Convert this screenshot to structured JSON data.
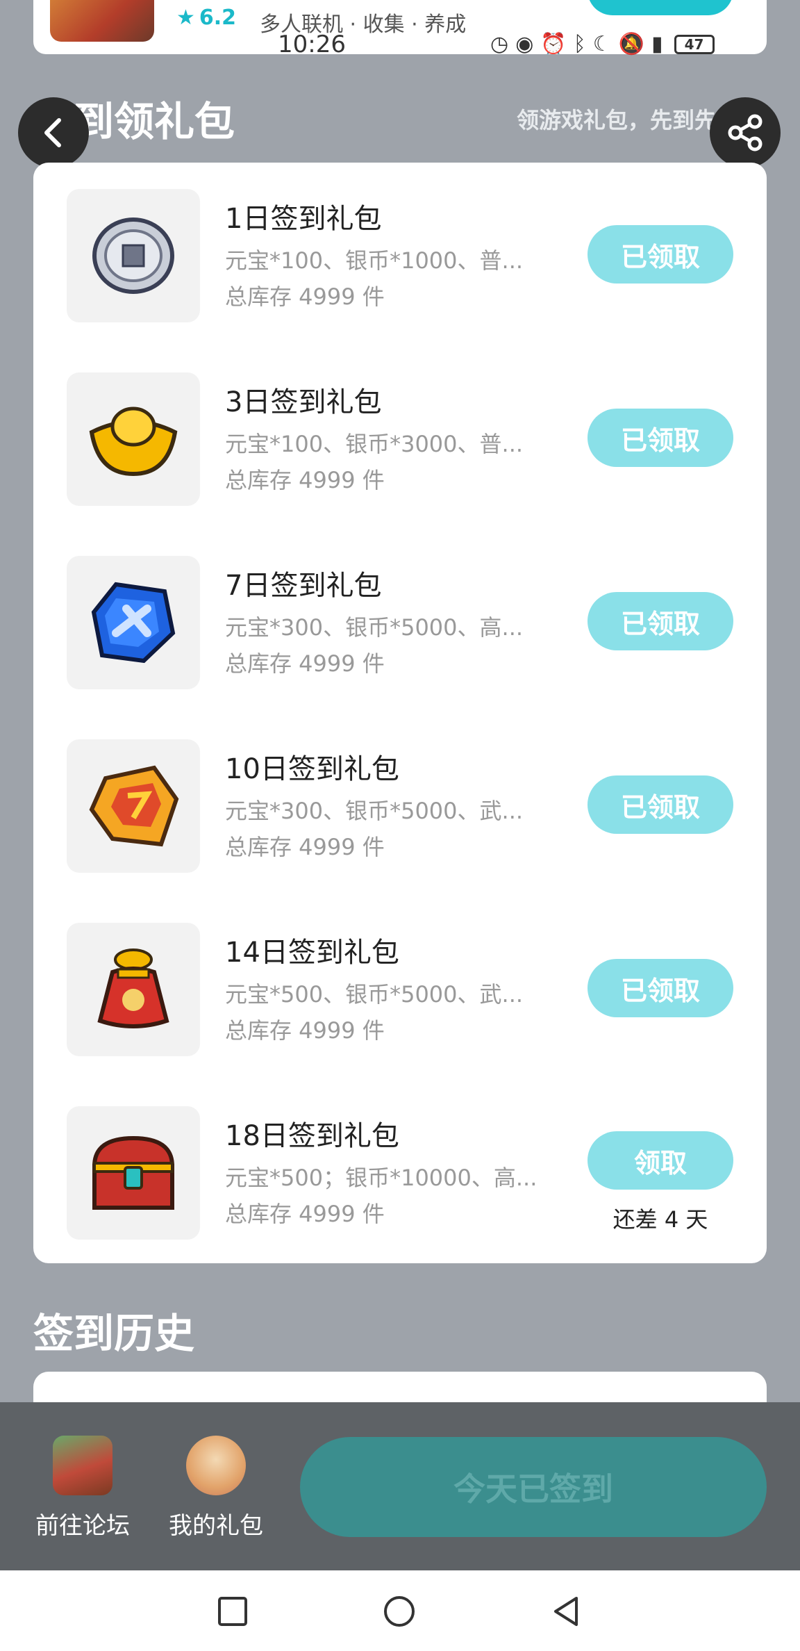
{
  "top_game": {
    "rating": "6.2",
    "tags": "多人联机 · 收集 · 养成"
  },
  "status_bar": {
    "time": "10:26",
    "battery": "47"
  },
  "header": {
    "title": "签到领礼包",
    "subtitle": "领游戏礼包，先到先得"
  },
  "gifts": [
    {
      "name": "1日签到礼包",
      "desc": "元宝*100、银币*1000、普...",
      "stock": "总库存 4999 件",
      "button": "已领取",
      "icon": "silver-coin-icon"
    },
    {
      "name": "3日签到礼包",
      "desc": "元宝*100、银币*3000、普...",
      "stock": "总库存 4999 件",
      "button": "已领取",
      "icon": "gold-ingot-icon"
    },
    {
      "name": "7日签到礼包",
      "desc": "元宝*300、银币*5000、高...",
      "stock": "总库存 4999 件",
      "button": "已领取",
      "icon": "blue-gem-icon"
    },
    {
      "name": "10日签到礼包",
      "desc": "元宝*300、银币*5000、武...",
      "stock": "总库存 4999 件",
      "button": "已领取",
      "icon": "gold-token-icon"
    },
    {
      "name": "14日签到礼包",
      "desc": "元宝*500、银币*5000、武...",
      "stock": "总库存 4999 件",
      "button": "已领取",
      "icon": "lucky-bag-icon"
    },
    {
      "name": "18日签到礼包",
      "desc": "元宝*500；银币*10000、高...",
      "stock": "总库存 4999 件",
      "button": "领取",
      "remain": "还差 4 天",
      "icon": "treasure-chest-icon"
    }
  ],
  "history": {
    "title": "签到历史"
  },
  "bottom_bar": {
    "forum_label": "前往论坛",
    "my_gifts_label": "我的礼包",
    "signed_label": "今天已签到"
  },
  "colors": {
    "accent": "#1fc3cf",
    "claimed_button": "#8ae0e8",
    "signed_button": "#3b8e8e",
    "page_bg": "#9ea3aa"
  }
}
